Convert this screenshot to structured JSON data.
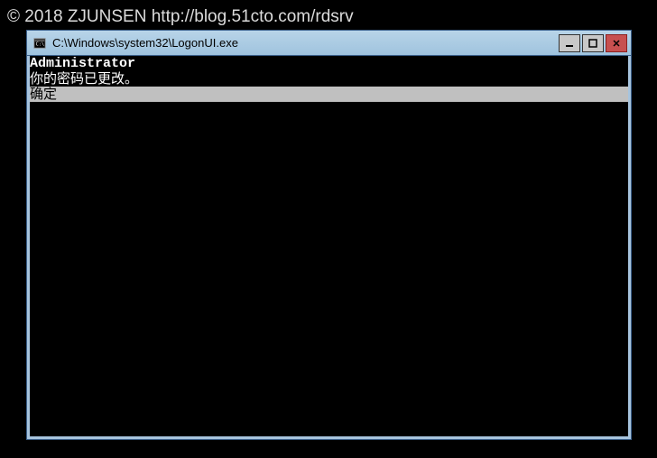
{
  "watermark": "© 2018 ZJUNSEN http://blog.51cto.com/rdsrv",
  "window": {
    "title": "C:\\Windows\\system32\\LogonUI.exe"
  },
  "console": {
    "username": "Administrator",
    "message": "你的密码已更改。",
    "button_label": "确定"
  }
}
